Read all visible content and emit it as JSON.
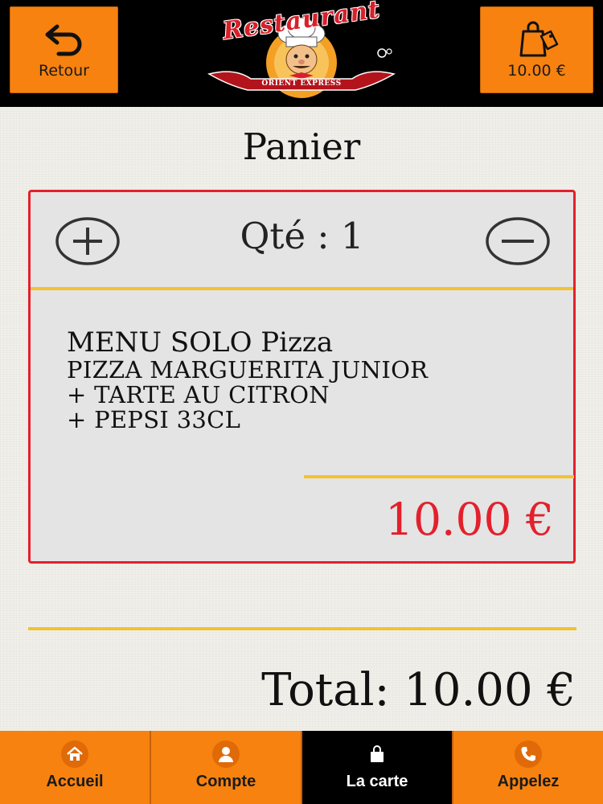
{
  "header": {
    "back_label": "Retour",
    "cart_total": "10.00 €",
    "logo_title": "Restaurant",
    "logo_subtitle": "ORIENT EXPRESS"
  },
  "page_title": "Panier",
  "cart_item": {
    "quantity_label": "Qté : 1",
    "name": "MENU SOLO Pizza",
    "lines": [
      "PIZZA MARGUERITA JUNIOR",
      "+ TARTE AU CITRON",
      "+ PEPSI 33CL"
    ],
    "price": "10.00 €"
  },
  "total": "Total: 10.00 €",
  "bottom_nav": {
    "items": [
      {
        "label": "Accueil",
        "icon": "home-icon",
        "active": false
      },
      {
        "label": "Compte",
        "icon": "user-icon",
        "active": false
      },
      {
        "label": "La carte",
        "icon": "shopping-bag-icon",
        "active": true
      },
      {
        "label": "Appelez",
        "icon": "phone-icon",
        "active": false
      }
    ]
  },
  "colors": {
    "accent_orange": "#f7820f",
    "price_red": "#e3202c",
    "divider_yellow": "#f2c230",
    "header_black": "#000000"
  }
}
